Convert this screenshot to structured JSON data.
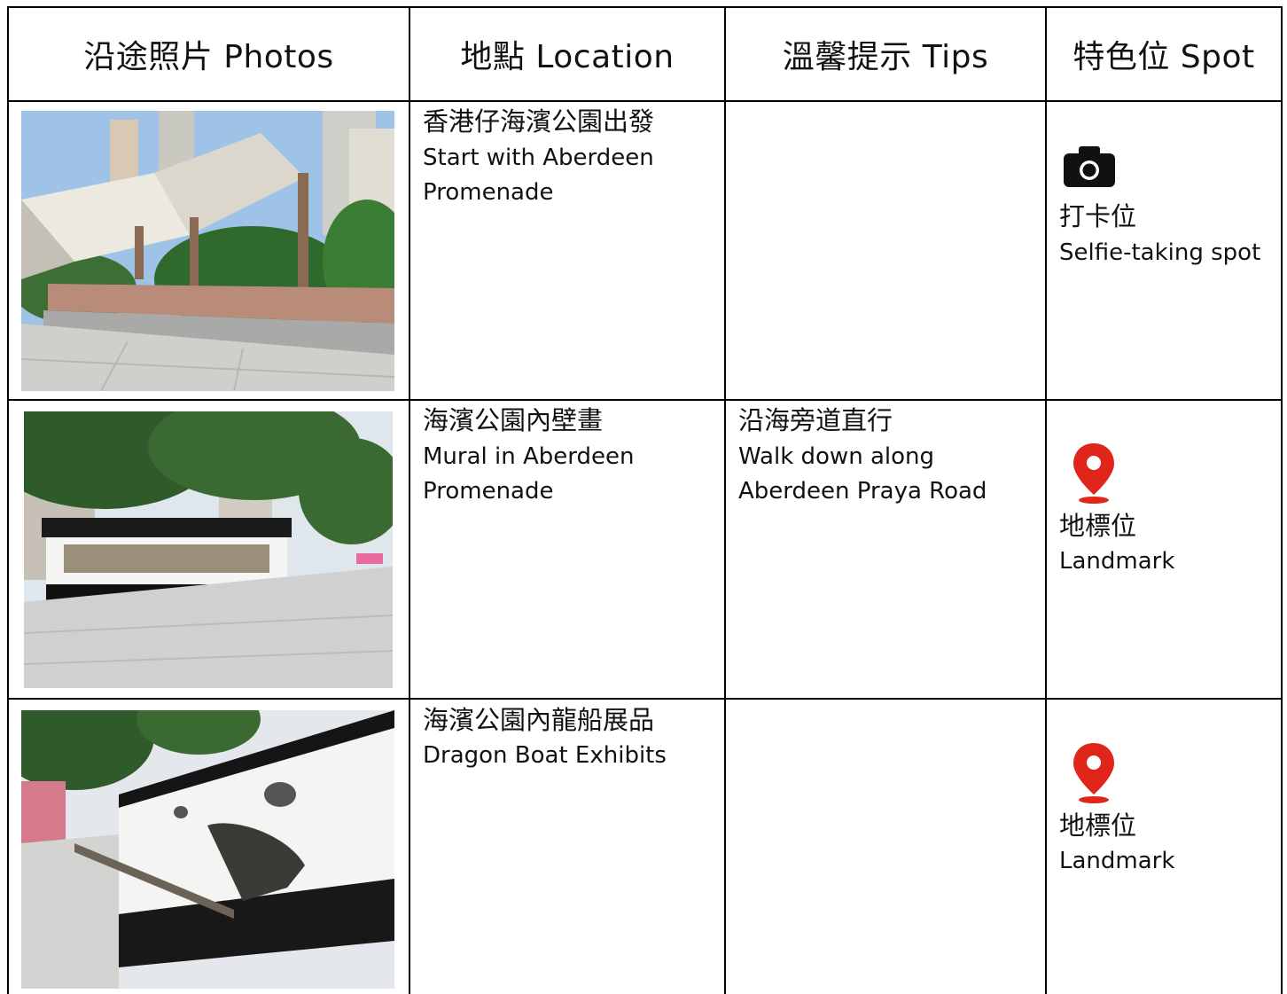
{
  "headers": {
    "photos": "沿途照片  Photos",
    "location": "地點  Location",
    "tips": "溫馨提示 Tips",
    "spot": "特色位 Spot"
  },
  "rows": [
    {
      "photo_icon": "promenade-canopy-photo",
      "location_zh": "香港仔海濱公園出發",
      "location_en": "Start with Aberdeen Promenade",
      "tips_zh": "",
      "tips_en": "",
      "spot_icon": "camera-icon",
      "spot_zh": "打卡位",
      "spot_en": "Selfie-taking spot"
    },
    {
      "photo_icon": "mural-wall-photo",
      "location_zh": "海濱公園內壁畫",
      "location_en": "Mural in Aberdeen Promenade",
      "tips_zh": "沿海旁道直行",
      "tips_en": "Walk down along Aberdeen Praya Road",
      "spot_icon": "map-pin-icon",
      "spot_zh": "地標位",
      "spot_en": "Landmark"
    },
    {
      "photo_icon": "dragon-boat-photo",
      "location_zh": "海濱公園內龍船展品",
      "location_en": "Dragon Boat Exhibits",
      "tips_zh": "",
      "tips_en": "",
      "spot_icon": "map-pin-icon",
      "spot_zh": "地標位",
      "spot_en": "Landmark"
    }
  ],
  "colors": {
    "pin": "#e0261b",
    "camera": "#111111",
    "border": "#000000"
  }
}
